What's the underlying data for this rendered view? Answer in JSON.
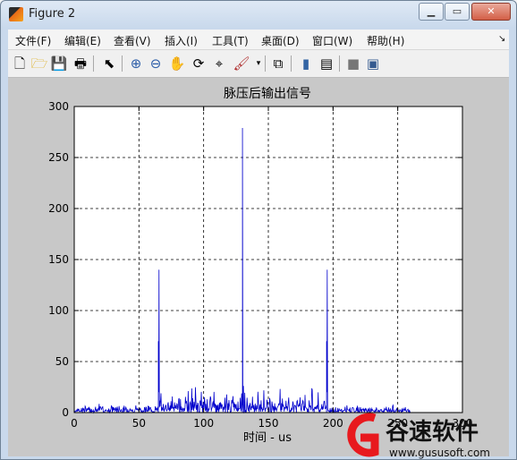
{
  "window": {
    "title": "Figure 2"
  },
  "menu": [
    "文件(F)",
    "编辑(E)",
    "查看(V)",
    "插入(I)",
    "工具(T)",
    "桌面(D)",
    "窗口(W)",
    "帮助(H)"
  ],
  "chart_data": {
    "type": "line",
    "title": "脉压后输出信号",
    "xlabel": "时间 - us",
    "ylabel": "",
    "xlim": [
      0,
      300
    ],
    "ylim": [
      0,
      300
    ],
    "xticks": [
      0,
      50,
      100,
      150,
      200,
      250,
      300
    ],
    "yticks": [
      0,
      50,
      100,
      150,
      200,
      250,
      300
    ],
    "grid": true,
    "series": [
      {
        "color": "#0000cc",
        "peaks": [
          {
            "x": 65,
            "y": 70
          },
          {
            "x": 65.5,
            "y": 140
          },
          {
            "x": 130,
            "y": 279
          },
          {
            "x": 195,
            "y": 70
          },
          {
            "x": 195.5,
            "y": 140
          }
        ],
        "baseline_before": [
          0,
          65,
          5
        ],
        "baseline_middle": [
          66,
          195,
          12
        ],
        "baseline_after": [
          196,
          260,
          4
        ]
      }
    ]
  },
  "watermark": {
    "brand": "谷速软件",
    "url": "www.gususoft.com"
  }
}
